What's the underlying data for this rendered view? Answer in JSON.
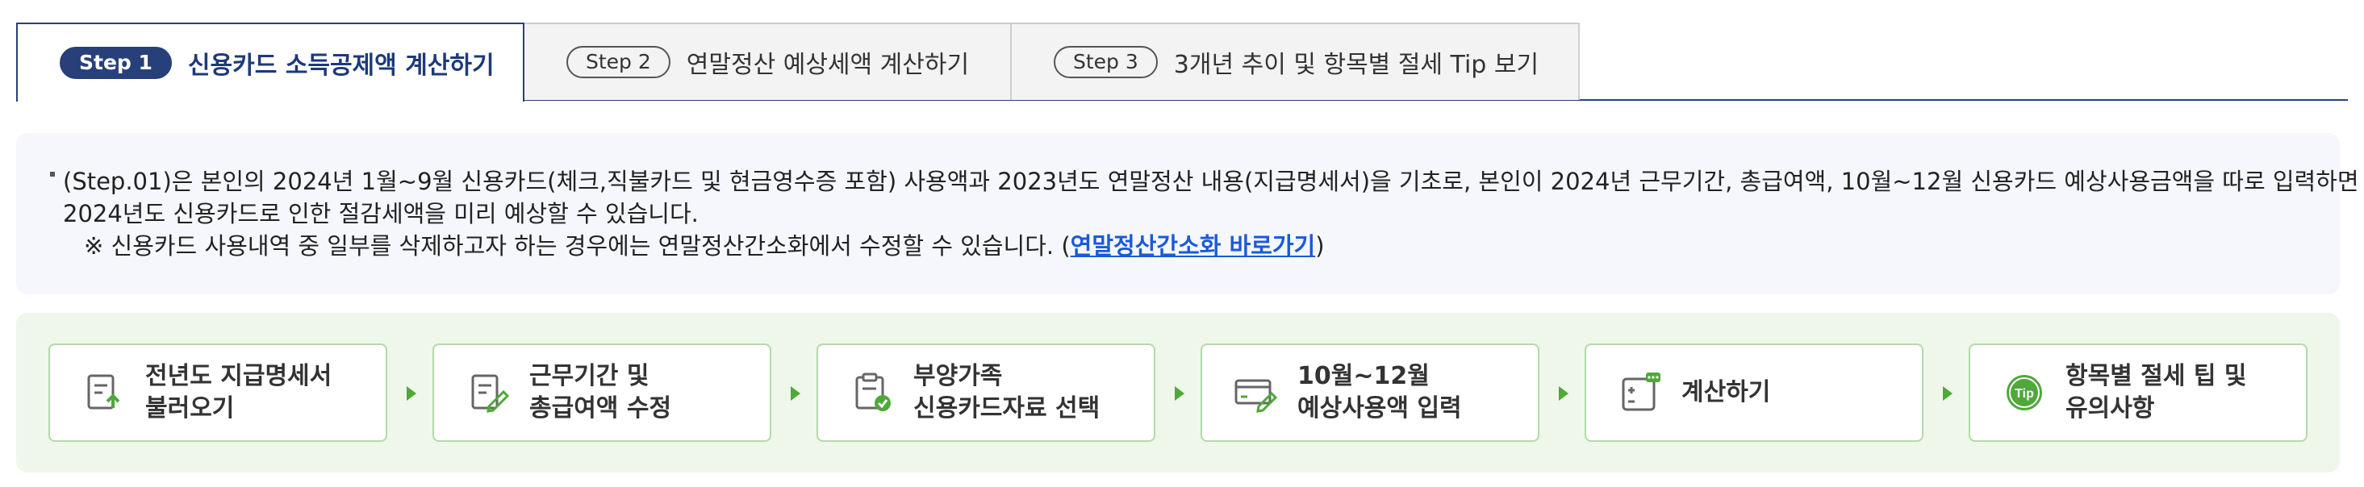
{
  "tabs": [
    {
      "step": "Step 1",
      "label": "신용카드 소득공제액 계산하기",
      "active": true
    },
    {
      "step": "Step 2",
      "label": "연말정산 예상세액 계산하기",
      "active": false
    },
    {
      "step": "Step 3",
      "label": "3개년 추이 및 항목별 절세 Tip 보기",
      "active": false
    }
  ],
  "info": {
    "line1": "(Step.01)은 본인의 2024년 1월~9월 신용카드(체크,직불카드 및 현금영수증 포함) 사용액과 2023년도 연말정산 내용(지급명세서)을 기초로, 본인이 2024년 근무기간, 총급여액, 10월~12월 신용카드 예상사용금액을 따로 입력하면",
    "line2": "2024년도 신용카드로 인한 절감세액을 미리 예상할 수 있습니다.",
    "note_prefix": "※ 신용카드 사용내역 중 일부를 삭제하고자 하는 경우에는 연말정산간소화에서 수정할 수 있습니다. (",
    "note_link": "연말정산간소화 바로가기",
    "note_suffix": ")"
  },
  "steps": [
    {
      "label": "전년도 지급명세서\n불러오기",
      "icon": "document-upload-icon"
    },
    {
      "label": "근무기간 및\n총급여액 수정",
      "icon": "document-edit-icon"
    },
    {
      "label": "부양가족\n신용카드자료 선택",
      "icon": "clipboard-check-icon"
    },
    {
      "label": "10월~12월\n예상사용액 입력",
      "icon": "card-input-icon"
    },
    {
      "label": "계산하기",
      "icon": "calculator-icon"
    },
    {
      "label": "항목별 절세 팁 및\n유의사항",
      "icon": "tip-icon"
    }
  ],
  "colors": {
    "accent_navy": "#28407a",
    "link_blue": "#1a5ad8",
    "process_green": "#4fa83a",
    "process_bg": "#eef7ea",
    "info_bg": "#f5f7fd"
  }
}
